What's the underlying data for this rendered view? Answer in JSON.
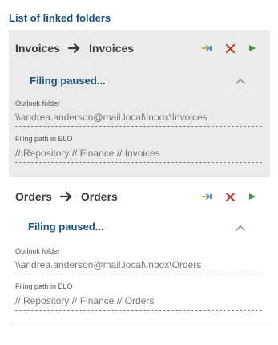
{
  "header": {
    "title": "List of linked folders"
  },
  "links": [
    {
      "source": "Invoices",
      "target": "Invoices",
      "status": "Filing paused...",
      "outlook_label": "Outlook folder",
      "outlook_value": "\\\\andrea.anderson@mail.local\\Inbox\\Invoices",
      "elo_label": "Filing path in ELO",
      "elo_value": "// Repository // Finance // Invoices"
    },
    {
      "source": "Orders",
      "target": "Orders",
      "status": "Filing paused...",
      "outlook_label": "Outlook folder",
      "outlook_value": "\\\\andrea.anderson@mail.local\\Inbox\\Orders",
      "elo_label": "Filing path in ELO",
      "elo_value": "// Repository // Finance // Orders"
    }
  ],
  "icons": {
    "link": "link-icon",
    "remove": "remove-icon",
    "play": "play-icon",
    "arrow": "arrow-right-icon",
    "collapse": "chevron-up-icon"
  },
  "colors": {
    "accent": "#1d4f7d",
    "remove": "#c0392b",
    "play": "#3a9a3a",
    "link": "#e8a33a",
    "selected_bg": "#ebebeb"
  }
}
